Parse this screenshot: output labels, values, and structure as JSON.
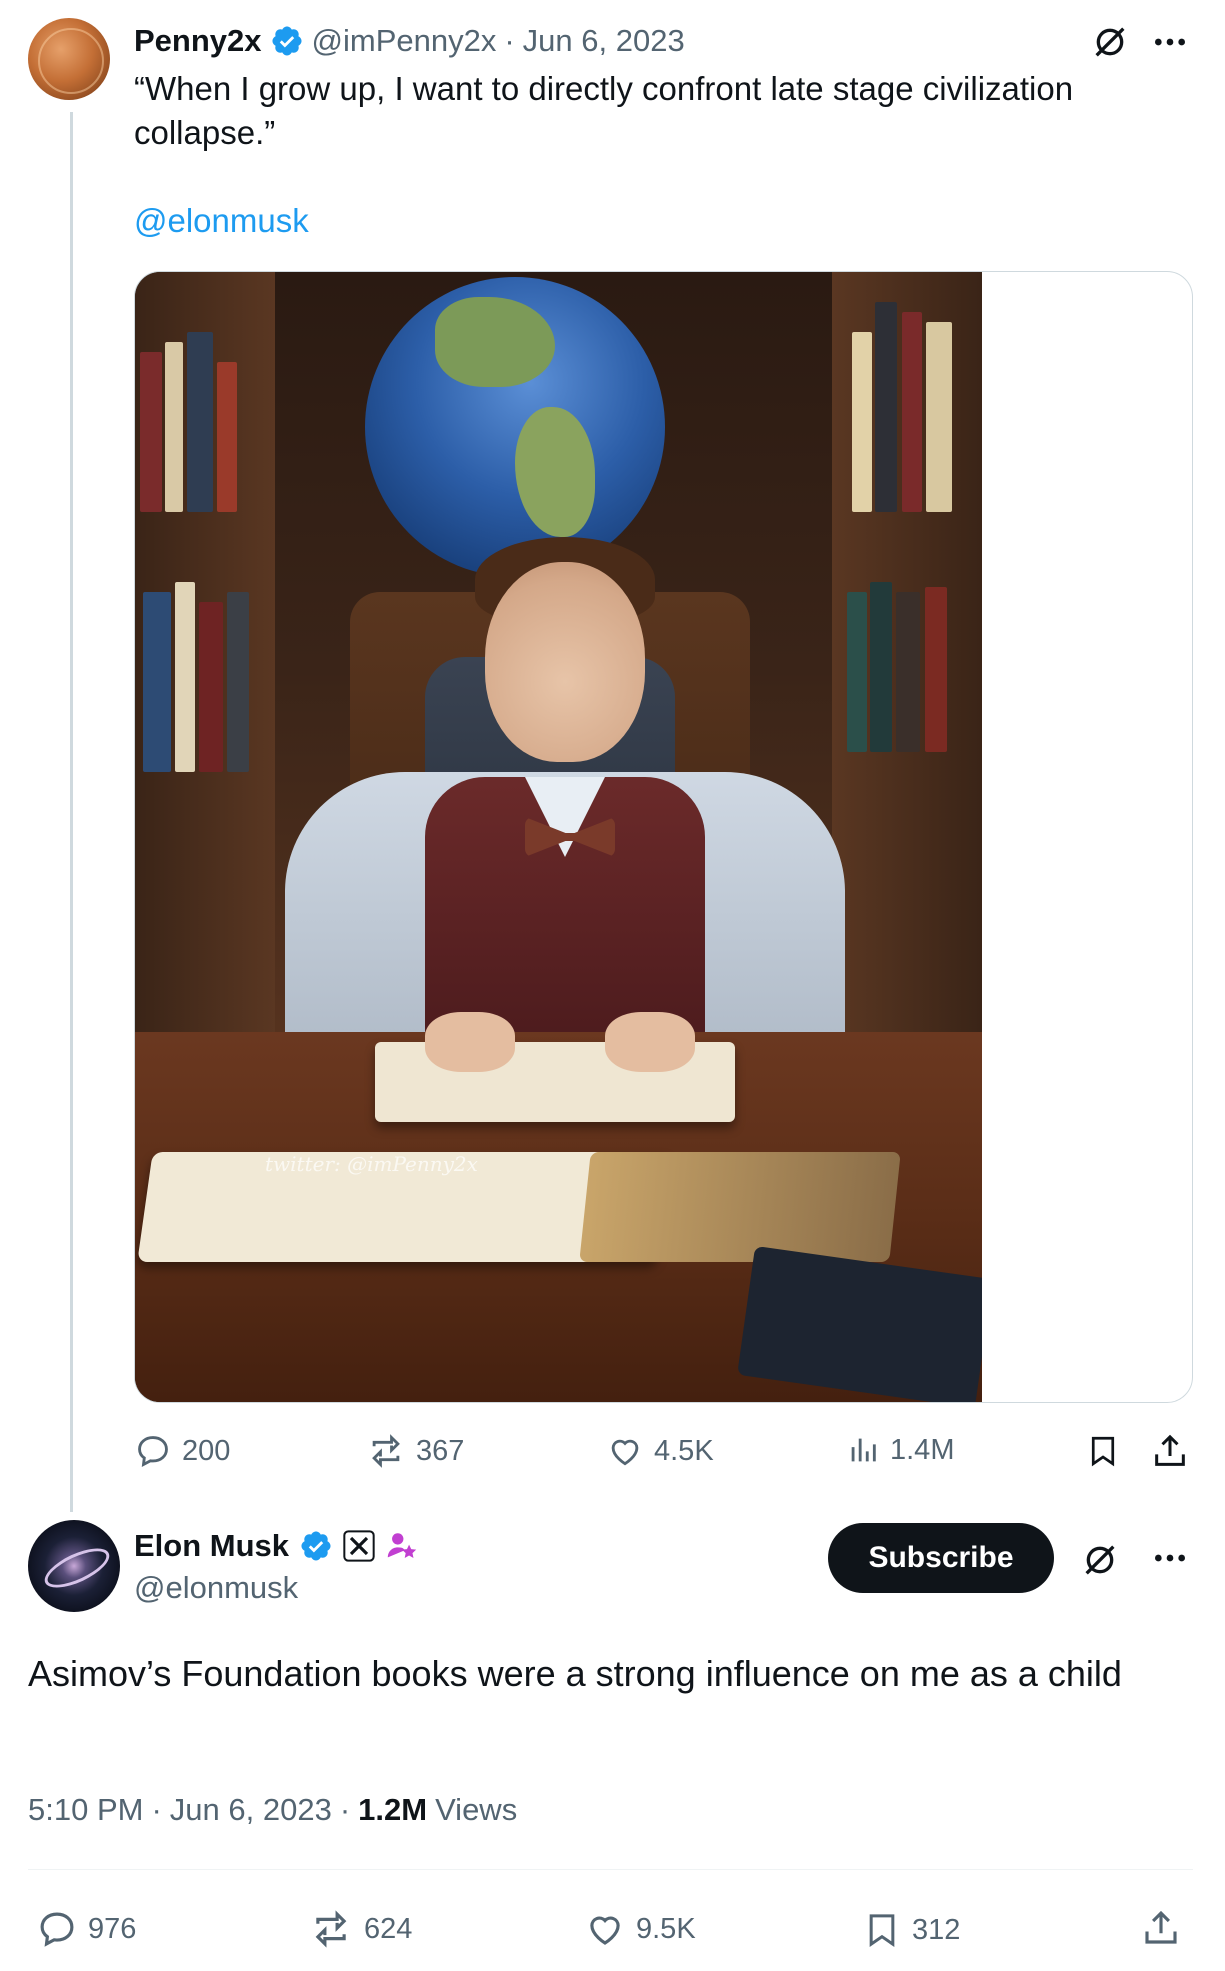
{
  "quoted": {
    "name": "Penny2x",
    "handle": "@imPenny2x",
    "separator": "·",
    "date": "Jun 6, 2023",
    "text": "“When I grow up, I want to directly confront late stage civilization collapse.”",
    "mention": "@elonmusk",
    "watermark": "twitter: @imPenny2x",
    "replies": "200",
    "reposts": "367",
    "likes": "4.5K",
    "views": "1.4M"
  },
  "main": {
    "name": "Elon Musk",
    "handle": "@elonmusk",
    "subscribe_label": "Subscribe",
    "text": "Asimov’s Foundation books were a strong influence on me as a child",
    "time": "5:10 PM",
    "dot": "·",
    "date": "Jun 6, 2023",
    "views_count": "1.2M",
    "views_label": "Views",
    "replies": "976",
    "reposts": "624",
    "likes": "9.5K",
    "bookmarks": "312"
  },
  "colors": {
    "accent": "#1d9bf0",
    "text": "#0f1419",
    "muted": "#536471",
    "verified": "#1d9bf0",
    "affiliate": "#c13fd1"
  },
  "icons": [
    "verified-badge-icon",
    "grok-icon",
    "more-icon",
    "reply-icon",
    "repost-icon",
    "like-icon",
    "views-icon",
    "bookmark-icon",
    "share-icon",
    "x-logo-icon",
    "affiliate-icon"
  ]
}
